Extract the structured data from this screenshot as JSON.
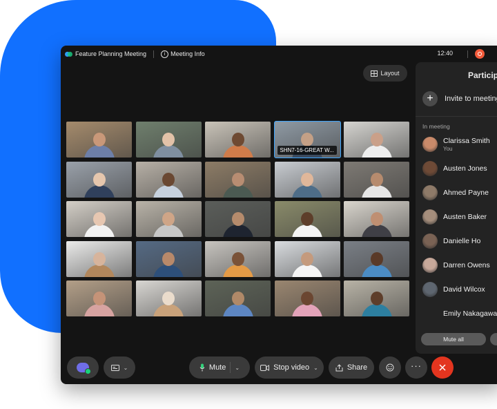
{
  "window": {
    "title": "Feature Planning Meeting",
    "meeting_info": "Meeting Info",
    "time": "12:40"
  },
  "toolbar_top": {
    "layout_label": "Layout"
  },
  "colors": {
    "accent_blue": "#1170ff",
    "end_call": "#e3351f",
    "active_tile": "#3ea6ff",
    "recording": "#f25a3a"
  },
  "video_grid": {
    "active_tile_label": "SHN7-16-GREAT W...",
    "tiles": [
      {
        "bg": "#a58b6c",
        "skin": "#c99879",
        "shirt": "#6d7fa8"
      },
      {
        "bg": "#6f7f6d",
        "skin": "#e2c2a8",
        "shirt": "#7f8fa0"
      },
      {
        "bg": "#c9c3b8",
        "skin": "#6e4a32",
        "shirt": "#d07c4a"
      },
      {
        "bg": "#8f9aa4",
        "skin": "#c4a086",
        "shirt": "#3b4b5e",
        "active": true
      },
      {
        "bg": "#d5d4d0",
        "skin": "#caa089",
        "shirt": "#eeeeee"
      },
      {
        "bg": "#9aa1aa",
        "skin": "#e5c6ad",
        "shirt": "#30405c"
      },
      {
        "bg": "#b7b0a6",
        "skin": "#6a4832",
        "shirt": "#c6d1de"
      },
      {
        "bg": "#8d7c66",
        "skin": "#b88d72",
        "shirt": "#4b5a52"
      },
      {
        "bg": "#c8ccd1",
        "skin": "#e0b79a",
        "shirt": "#4e6d88"
      },
      {
        "bg": "#7e7a74",
        "skin": "#b68b6e",
        "shirt": "#e6e6e6"
      },
      {
        "bg": "#d4cfc7",
        "skin": "#e7c7b1",
        "shirt": "#f2f2f2"
      },
      {
        "bg": "#b9b3a8",
        "skin": "#cfa587",
        "shirt": "#c7c7c7"
      },
      {
        "bg": "#5b5e5a",
        "skin": "#b58b6c",
        "shirt": "#1e2430"
      },
      {
        "bg": "#8a8b6a",
        "skin": "#5d3e2a",
        "shirt": "#f4f4f4"
      },
      {
        "bg": "#d9d5cd",
        "skin": "#bf8f72",
        "shirt": "#3f3f46"
      },
      {
        "bg": "#ebebea",
        "skin": "#d7b49c",
        "shirt": "#b2875c"
      },
      {
        "bg": "#556a84",
        "skin": "#b8896a",
        "shirt": "#2d4f7a"
      },
      {
        "bg": "#c7c4bf",
        "skin": "#7a5238",
        "shirt": "#e59b46"
      },
      {
        "bg": "#d9dcdf",
        "skin": "#c49a7d",
        "shirt": "#f5f5f5"
      },
      {
        "bg": "#7a7f86",
        "skin": "#5a3a28",
        "shirt": "#4b8cc4"
      },
      {
        "bg": "#b39f88",
        "skin": "#c59378",
        "shirt": "#d7a3a1"
      },
      {
        "bg": "#d8d6d2",
        "skin": "#eadccc",
        "shirt": "#c9a27a"
      },
      {
        "bg": "#5d6357",
        "skin": "#b08968",
        "shirt": "#5d86c2"
      },
      {
        "bg": "#9a8670",
        "skin": "#6b4631",
        "shirt": "#e3a3b9"
      },
      {
        "bg": "#b8b3a6",
        "skin": "#5e3e2a",
        "shirt": "#2d7fa0"
      }
    ]
  },
  "participants_panel": {
    "title": "Participants",
    "invite_label": "Invite to meeting",
    "section_label": "In meeting",
    "mute_all_label": "Mute all",
    "participants": [
      {
        "name": "Clarissa Smith",
        "sub": "You",
        "color": "#c98a6a"
      },
      {
        "name": "Austen Jones",
        "sub": "",
        "color": "#6e4a36"
      },
      {
        "name": "Ahmed Payne",
        "sub": "",
        "color": "#8e7a68"
      },
      {
        "name": "Austen Baker",
        "sub": "",
        "color": "#a58e7c"
      },
      {
        "name": "Danielle Ho",
        "sub": "",
        "color": "#7a6254"
      },
      {
        "name": "Darren Owens",
        "sub": "",
        "color": "#c7a89a"
      },
      {
        "name": "David Wilcox",
        "sub": "",
        "color": "#5e6670"
      },
      {
        "name": "Emily Nakagawa",
        "sub": "",
        "color": ""
      }
    ]
  },
  "controls": {
    "mute_label": "Mute",
    "stop_video_label": "Stop video",
    "share_label": "Share"
  }
}
